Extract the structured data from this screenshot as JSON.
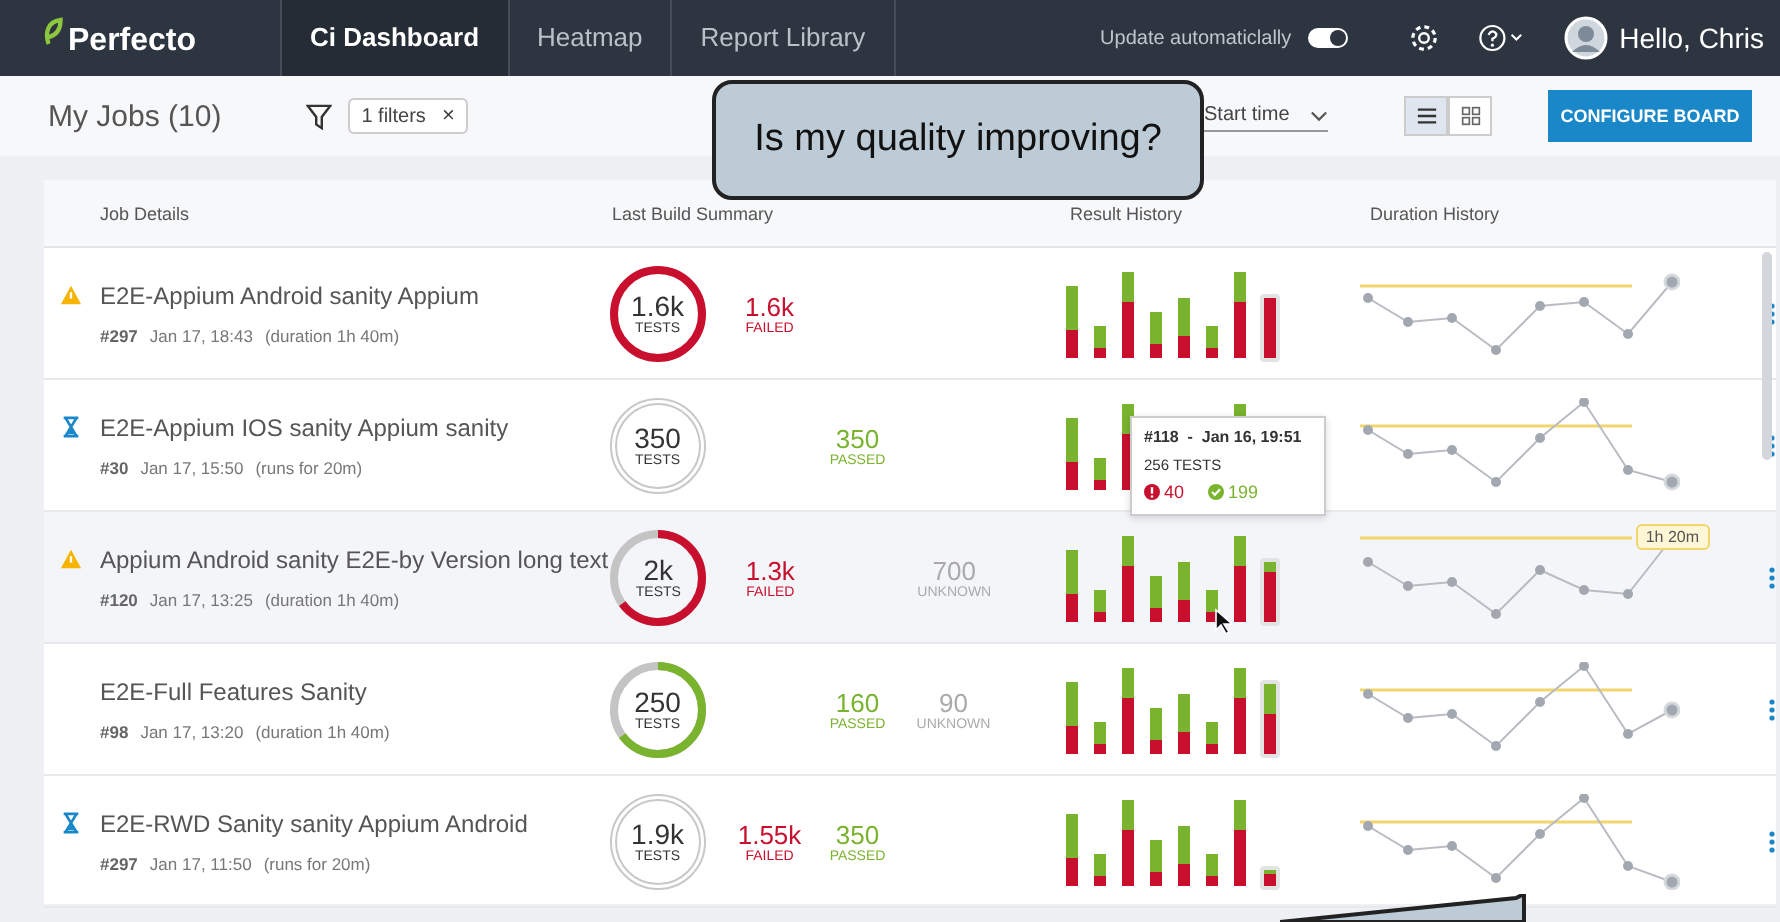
{
  "header": {
    "logo": "Perfecto",
    "nav": [
      {
        "label": "Ci Dashboard",
        "selected": true
      },
      {
        "label": "Heatmap",
        "selected": false
      },
      {
        "label": "Report Library",
        "selected": false
      }
    ],
    "auto_update": {
      "label": "Update automaticlally",
      "on": true
    },
    "user": "Hello, Chris"
  },
  "toolbar": {
    "title": "My Jobs (10)",
    "filter_chip": "1 filters",
    "filter_remove": "×",
    "sort": "Start time",
    "views": [
      {
        "kind": "list",
        "selected": true
      },
      {
        "kind": "grid",
        "selected": false
      }
    ],
    "configure": "CONFIGURE BOARD"
  },
  "callout": "Is my quality improving?",
  "table": {
    "columns": [
      "Job Details",
      "Last Build Summary",
      "Result History",
      "Duration History"
    ],
    "rows": [
      {
        "kind": "warning",
        "name": "E2E-Appium Android sanity Appium",
        "build": "#297",
        "time": "Jan 17, 18:43",
        "note": "(duration 1h 40m)",
        "hovered": false,
        "tests": "1.6k",
        "tests_label": "TESTS",
        "ring": {
          "kind": "full",
          "color": "#c8102e"
        },
        "stats": [
          {
            "kind": "failed",
            "value": "1.6k",
            "label": "FAILED"
          }
        ]
      },
      {
        "kind": "running",
        "name": "E2E-Appium IOS sanity Appium sanity",
        "build": "#30",
        "time": "Jan 17, 15:50",
        "note": "(runs for 20m)",
        "hovered": false,
        "tests": "350",
        "tests_label": "TESTS",
        "ring": {
          "kind": "running"
        },
        "stats": [
          {
            "kind": "passed",
            "value": "350",
            "label": "PASSED"
          }
        ]
      },
      {
        "kind": "warning",
        "name": "Appium Android sanity E2E-by Version long text",
        "build": "#120",
        "time": "Jan 17, 13:25",
        "note": "(duration 1h 40m)",
        "hovered": true,
        "tests": "2k",
        "tests_label": "TESTS",
        "ring": {
          "kind": "partial",
          "color": "#c8102e"
        },
        "stats": [
          {
            "kind": "failed",
            "value": "1.3k",
            "label": "FAILED"
          },
          {
            "kind": "unknown",
            "value": "700",
            "label": "UNKNOWN"
          }
        ],
        "duration_badge": "1h 20m"
      },
      {
        "kind": "plain",
        "name": "E2E-Full Features Sanity",
        "build": "#98",
        "time": "Jan 17, 13:20",
        "note": "(duration 1h 40m)",
        "hovered": false,
        "tests": "250",
        "tests_label": "TESTS",
        "ring": {
          "kind": "partial",
          "color": "#7ab32e"
        },
        "stats": [
          {
            "kind": "passed",
            "value": "160",
            "label": "PASSED"
          },
          {
            "kind": "unknown",
            "value": "90",
            "label": "UNKNOWN"
          }
        ]
      },
      {
        "kind": "running",
        "name": "E2E-RWD Sanity sanity Appium Android",
        "build": "#297",
        "time": "Jan 17, 11:50",
        "note": "(runs for 20m)",
        "hovered": false,
        "tests": "1.9k",
        "tests_label": "TESTS",
        "ring": {
          "kind": "running"
        },
        "stats": [
          {
            "kind": "failed",
            "value": "1.55k",
            "label": "FAILED"
          },
          {
            "kind": "passed",
            "value": "350",
            "label": "PASSED"
          }
        ]
      }
    ]
  },
  "tooltip": {
    "title": "#118  -  Jan 16, 19:51",
    "tests": "256 TESTS",
    "failed": "40",
    "passed": "199"
  }
}
